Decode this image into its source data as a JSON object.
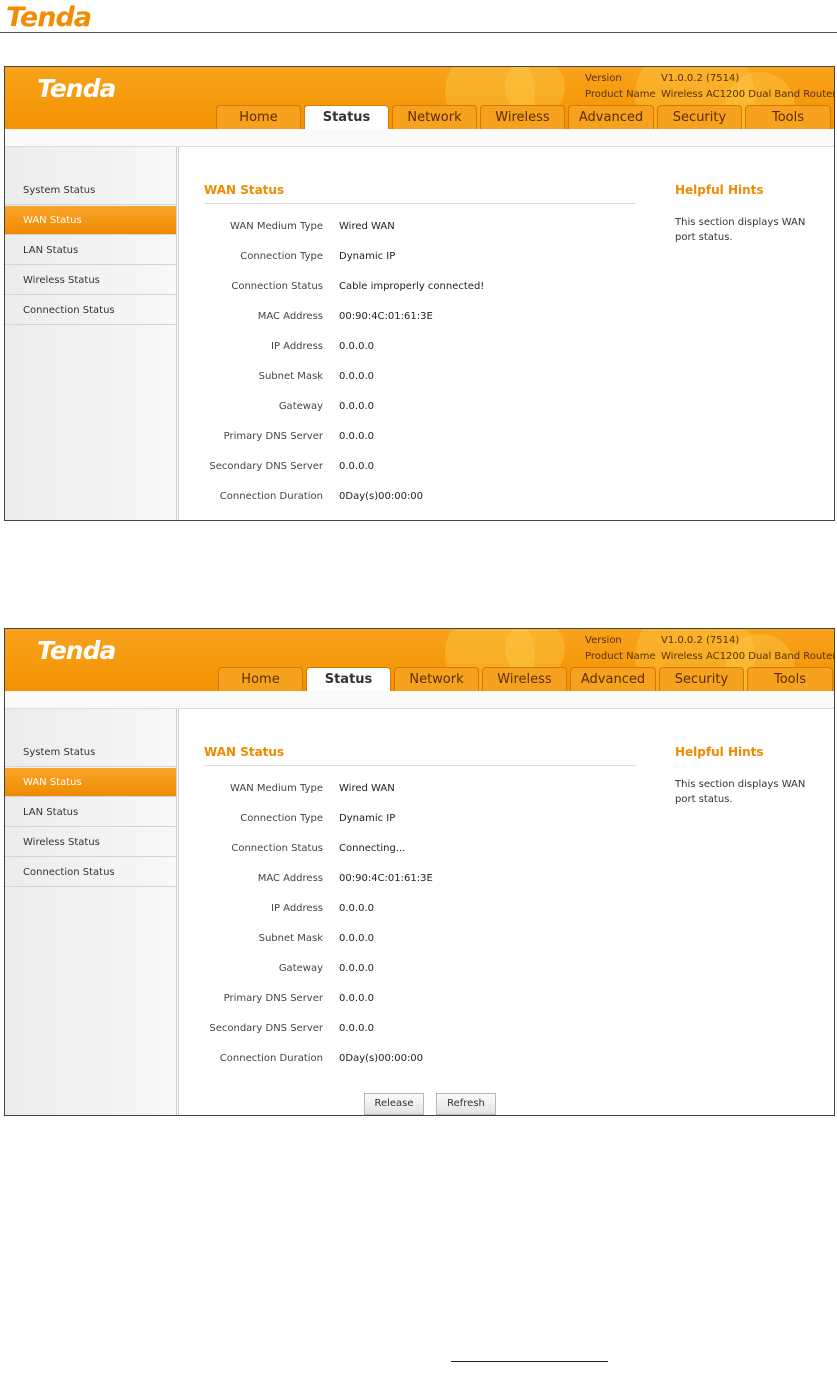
{
  "document": {
    "brand": "Tenda"
  },
  "screens": [
    {
      "header": {
        "logo": "Tenda",
        "version_label": "Version",
        "version_value": "V1.0.0.2 (7514)",
        "product_label": "Product Name",
        "product_value": "Wireless AC1200 Dual Band Router"
      },
      "tabs": [
        "Home",
        "Status",
        "Network",
        "Wireless",
        "Advanced",
        "Security",
        "Tools"
      ],
      "active_tab": "Status",
      "sidebar": [
        "System Status",
        "WAN Status",
        "LAN Status",
        "Wireless Status",
        "Connection Status"
      ],
      "active_sidebar": "WAN Status",
      "section_title": "WAN Status",
      "fields": [
        {
          "label": "WAN Medium Type",
          "value": "Wired WAN"
        },
        {
          "label": "Connection Type",
          "value": "Dynamic IP"
        },
        {
          "label": "Connection Status",
          "value": "Cable improperly connected!"
        },
        {
          "label": "MAC Address",
          "value": "00:90:4C:01:61:3E"
        },
        {
          "label": "IP Address",
          "value": "0.0.0.0"
        },
        {
          "label": "Subnet Mask",
          "value": "0.0.0.0"
        },
        {
          "label": "Gateway",
          "value": "0.0.0.0"
        },
        {
          "label": "Primary DNS Server",
          "value": "0.0.0.0"
        },
        {
          "label": "Secondary DNS Server",
          "value": "0.0.0.0"
        },
        {
          "label": "Connection Duration",
          "value": "0Day(s)00:00:00"
        }
      ],
      "hints": {
        "title": "Helpful Hints",
        "text": "This section displays WAN port status."
      }
    },
    {
      "header": {
        "logo": "Tenda",
        "version_label": "Version",
        "version_value": "V1.0.0.2 (7514)",
        "product_label": "Product Name",
        "product_value": "Wireless AC1200 Dual Band Router"
      },
      "tabs": [
        "Home",
        "Status",
        "Network",
        "Wireless",
        "Advanced",
        "Security",
        "Tools"
      ],
      "active_tab": "Status",
      "sidebar": [
        "System Status",
        "WAN Status",
        "LAN Status",
        "Wireless Status",
        "Connection Status"
      ],
      "active_sidebar": "WAN Status",
      "section_title": "WAN Status",
      "fields": [
        {
          "label": "WAN Medium Type",
          "value": "Wired WAN"
        },
        {
          "label": "Connection Type",
          "value": "Dynamic IP"
        },
        {
          "label": "Connection Status",
          "value": "Connecting..."
        },
        {
          "label": "MAC Address",
          "value": "00:90:4C:01:61:3E"
        },
        {
          "label": "IP Address",
          "value": "0.0.0.0"
        },
        {
          "label": "Subnet Mask",
          "value": "0.0.0.0"
        },
        {
          "label": "Gateway",
          "value": "0.0.0.0"
        },
        {
          "label": "Primary DNS Server",
          "value": "0.0.0.0"
        },
        {
          "label": "Secondary DNS Server",
          "value": "0.0.0.0"
        },
        {
          "label": "Connection Duration",
          "value": "0Day(s)00:00:00"
        }
      ],
      "buttons": {
        "release": "Release",
        "refresh": "Refresh"
      },
      "hints": {
        "title": "Helpful Hints",
        "text": "This section displays WAN port status."
      }
    }
  ]
}
